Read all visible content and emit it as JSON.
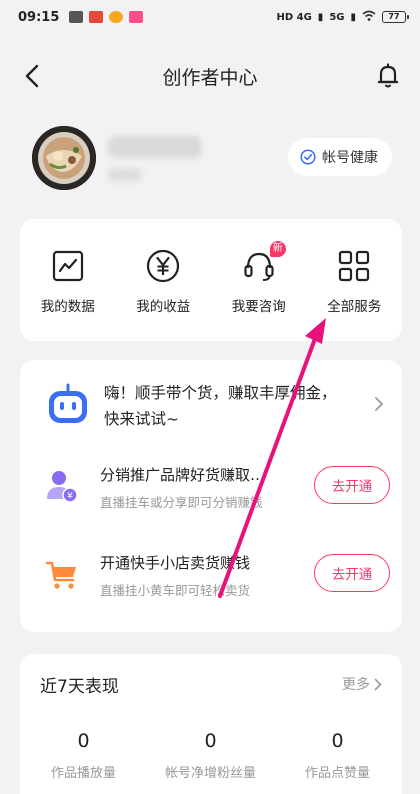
{
  "status_bar": {
    "time": "09:15",
    "network_1": "HD 4G",
    "network_2": "5G",
    "battery": "77"
  },
  "nav": {
    "title": "创作者中心"
  },
  "profile": {
    "health_label": "帐号健康"
  },
  "tools": [
    {
      "label": "我的数据",
      "icon": "chart-icon"
    },
    {
      "label": "我的收益",
      "icon": "yen-icon"
    },
    {
      "label": "我要咨询",
      "icon": "headset-icon",
      "badge": "新"
    },
    {
      "label": "全部服务",
      "icon": "grid-icon"
    }
  ],
  "promo": {
    "headline": "嗨！顺手带个货，赚取丰厚佣金，快来试试~",
    "rows": [
      {
        "title": "分销推广品牌好货赚取…",
        "subtitle": "直播挂车或分享即可分销赚钱",
        "button": "去开通"
      },
      {
        "title": "开通快手小店卖货赚钱",
        "subtitle": "直播挂小黄车即可轻松卖货",
        "button": "去开通"
      }
    ]
  },
  "stats": {
    "title": "近7天表现",
    "more": "更多",
    "items": [
      {
        "value": "0",
        "label": "作品播放量"
      },
      {
        "value": "0",
        "label": "帐号净增粉丝量"
      },
      {
        "value": "0",
        "label": "作品点赞量"
      }
    ]
  },
  "colors": {
    "accent": "#fe3666",
    "annotation_arrow": "#e8127c",
    "bot_blue": "#3a6ef5",
    "cart_orange": "#ff8a3d",
    "user_purple": "#8a6cf0"
  }
}
